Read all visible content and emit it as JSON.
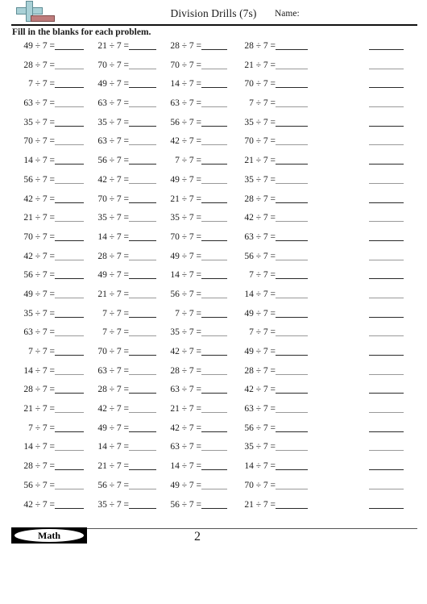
{
  "header": {
    "title": "Division Drills (7s)",
    "name_label": "Name:",
    "instructions": "Fill in the blanks for each problem.",
    "logo_icon": "plus-bar-logo-icon"
  },
  "footer": {
    "badge_label": "Math",
    "page_number": "2"
  },
  "worksheet": {
    "divisor": 7,
    "operator": "÷",
    "equals": "=",
    "columns": 4,
    "rows": 25,
    "answer_blank": "",
    "rows_data": [
      {
        "c1": "49 ÷ 7 =",
        "c2": "21 ÷ 7 =",
        "c3": "28 ÷ 7 =",
        "c4": "28 ÷ 7 ="
      },
      {
        "c1": "28 ÷ 7 =",
        "c2": "70 ÷ 7 =",
        "c3": "70 ÷ 7 =",
        "c4": "21 ÷ 7 ="
      },
      {
        "c1": "7 ÷ 7 =",
        "c2": "49 ÷ 7 =",
        "c3": "14 ÷ 7 =",
        "c4": "70 ÷ 7 ="
      },
      {
        "c1": "63 ÷ 7 =",
        "c2": "63 ÷ 7 =",
        "c3": "63 ÷ 7 =",
        "c4": "7 ÷ 7 ="
      },
      {
        "c1": "35 ÷ 7 =",
        "c2": "35 ÷ 7 =",
        "c3": "56 ÷ 7 =",
        "c4": "35 ÷ 7 ="
      },
      {
        "c1": "70 ÷ 7 =",
        "c2": "63 ÷ 7 =",
        "c3": "42 ÷ 7 =",
        "c4": "70 ÷ 7 ="
      },
      {
        "c1": "14 ÷ 7 =",
        "c2": "56 ÷ 7 =",
        "c3": "7 ÷ 7 =",
        "c4": "21 ÷ 7 ="
      },
      {
        "c1": "56 ÷ 7 =",
        "c2": "42 ÷ 7 =",
        "c3": "49 ÷ 7 =",
        "c4": "35 ÷ 7 ="
      },
      {
        "c1": "42 ÷ 7 =",
        "c2": "70 ÷ 7 =",
        "c3": "21 ÷ 7 =",
        "c4": "28 ÷ 7 ="
      },
      {
        "c1": "21 ÷ 7 =",
        "c2": "35 ÷ 7 =",
        "c3": "35 ÷ 7 =",
        "c4": "42 ÷ 7 ="
      },
      {
        "c1": "70 ÷ 7 =",
        "c2": "14 ÷ 7 =",
        "c3": "70 ÷ 7 =",
        "c4": "63 ÷ 7 ="
      },
      {
        "c1": "42 ÷ 7 =",
        "c2": "28 ÷ 7 =",
        "c3": "49 ÷ 7 =",
        "c4": "56 ÷ 7 ="
      },
      {
        "c1": "56 ÷ 7 =",
        "c2": "49 ÷ 7 =",
        "c3": "14 ÷ 7 =",
        "c4": "7 ÷ 7 ="
      },
      {
        "c1": "49 ÷ 7 =",
        "c2": "21 ÷ 7 =",
        "c3": "56 ÷ 7 =",
        "c4": "14 ÷ 7 ="
      },
      {
        "c1": "35 ÷ 7 =",
        "c2": "7 ÷ 7 =",
        "c3": "7 ÷ 7 =",
        "c4": "49 ÷ 7 ="
      },
      {
        "c1": "63 ÷ 7 =",
        "c2": "7 ÷ 7 =",
        "c3": "35 ÷ 7 =",
        "c4": "7 ÷ 7 ="
      },
      {
        "c1": "7 ÷ 7 =",
        "c2": "70 ÷ 7 =",
        "c3": "42 ÷ 7 =",
        "c4": "49 ÷ 7 ="
      },
      {
        "c1": "14 ÷ 7 =",
        "c2": "63 ÷ 7 =",
        "c3": "28 ÷ 7 =",
        "c4": "28 ÷ 7 ="
      },
      {
        "c1": "28 ÷ 7 =",
        "c2": "28 ÷ 7 =",
        "c3": "63 ÷ 7 =",
        "c4": "42 ÷ 7 ="
      },
      {
        "c1": "21 ÷ 7 =",
        "c2": "42 ÷ 7 =",
        "c3": "21 ÷ 7 =",
        "c4": "63 ÷ 7 ="
      },
      {
        "c1": "7 ÷ 7 =",
        "c2": "49 ÷ 7 =",
        "c3": "42 ÷ 7 =",
        "c4": "56 ÷ 7 ="
      },
      {
        "c1": "14 ÷ 7 =",
        "c2": "14 ÷ 7 =",
        "c3": "63 ÷ 7 =",
        "c4": "35 ÷ 7 ="
      },
      {
        "c1": "28 ÷ 7 =",
        "c2": "21 ÷ 7 =",
        "c3": "14 ÷ 7 =",
        "c4": "14 ÷ 7 ="
      },
      {
        "c1": "56 ÷ 7 =",
        "c2": "56 ÷ 7 =",
        "c3": "49 ÷ 7 =",
        "c4": "70 ÷ 7 ="
      },
      {
        "c1": "42 ÷ 7 =",
        "c2": "35 ÷ 7 =",
        "c3": "56 ÷ 7 =",
        "c4": "21 ÷ 7 ="
      }
    ]
  }
}
